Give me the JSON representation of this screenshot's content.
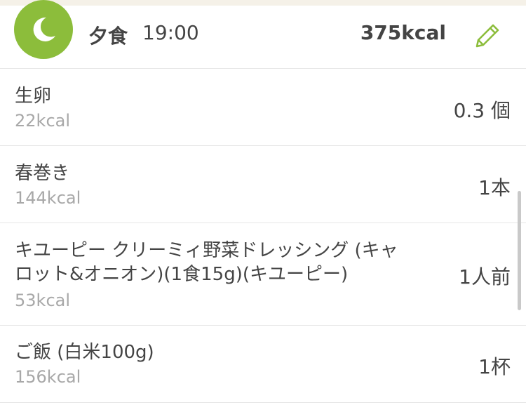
{
  "meal": {
    "title": "夕食",
    "time": "19:00",
    "total": "375kcal",
    "icon": "moon-icon",
    "edit_icon": "pencil-icon",
    "accent_color": "#8cbd3b"
  },
  "items": [
    {
      "name": "生卵",
      "kcal": "22kcal",
      "qty": "0.3 個"
    },
    {
      "name": "春巻き",
      "kcal": "144kcal",
      "qty": "1本"
    },
    {
      "name_line1": "キユーピー クリーミィ野菜ドレッシング (キャ",
      "name_line2": "ロット&オニオン)(1食15g)(キユーピー)",
      "kcal": "53kcal",
      "qty": "1人前"
    },
    {
      "name": "ご飯 (白米100g)",
      "kcal": "156kcal",
      "qty": "1杯"
    }
  ]
}
